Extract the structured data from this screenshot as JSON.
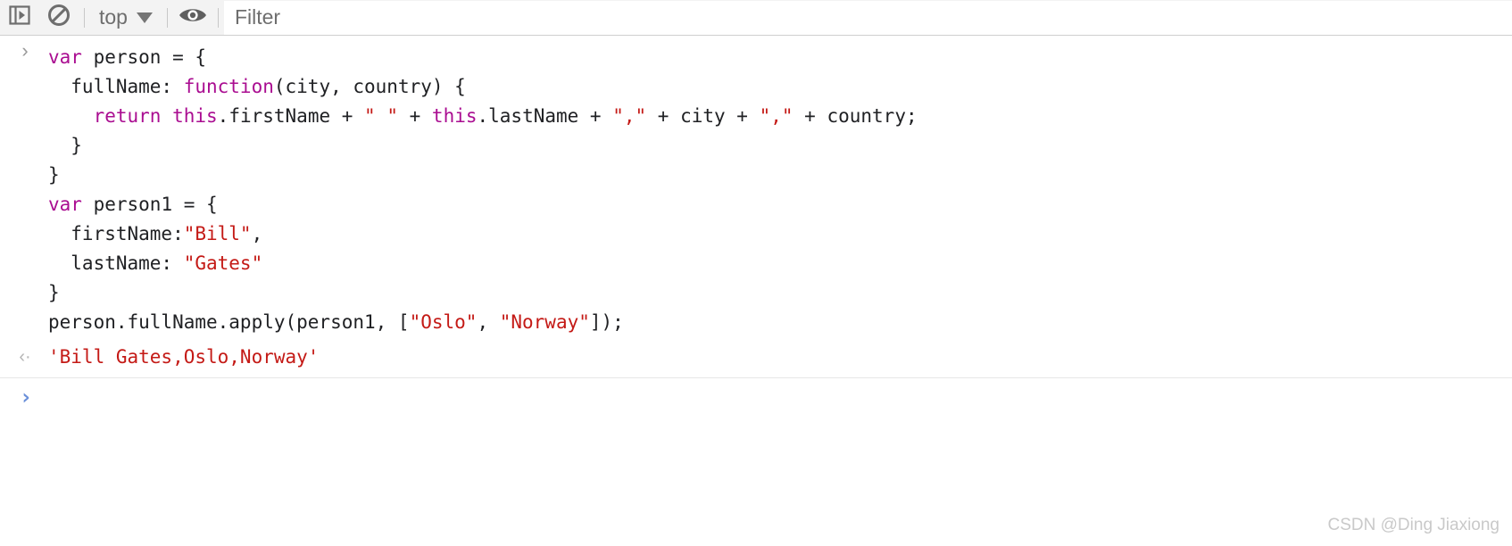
{
  "toolbar": {
    "drawer_toggle_icon": "sidebar-panel-icon",
    "clear_console_icon": "clear-console-icon",
    "context_label": "top",
    "context_caret_icon": "chevron-down-icon",
    "eye_icon": "eye-icon",
    "filter": {
      "placeholder": "Filter",
      "value": ""
    }
  },
  "console": {
    "input_marker": "›",
    "output_marker": "‹·",
    "prompt_marker": "›",
    "prompt_value": "",
    "entry": {
      "lines": [
        [
          {
            "t": "var",
            "c": "kw"
          },
          {
            "t": " person = {",
            "c": "pl"
          }
        ],
        [
          {
            "t": "  fullName: ",
            "c": "pl"
          },
          {
            "t": "function",
            "c": "kw"
          },
          {
            "t": "(city, country) {",
            "c": "pl"
          }
        ],
        [
          {
            "t": "    ",
            "c": "pl"
          },
          {
            "t": "return",
            "c": "kw"
          },
          {
            "t": " ",
            "c": "pl"
          },
          {
            "t": "this",
            "c": "kw"
          },
          {
            "t": ".firstName + ",
            "c": "pl"
          },
          {
            "t": "\" \"",
            "c": "str"
          },
          {
            "t": " + ",
            "c": "pl"
          },
          {
            "t": "this",
            "c": "kw"
          },
          {
            "t": ".lastName + ",
            "c": "pl"
          },
          {
            "t": "\",\"",
            "c": "str"
          },
          {
            "t": " + city + ",
            "c": "pl"
          },
          {
            "t": "\",\"",
            "c": "str"
          },
          {
            "t": " + country;",
            "c": "pl"
          }
        ],
        [
          {
            "t": "  }",
            "c": "pl"
          }
        ],
        [
          {
            "t": "}",
            "c": "pl"
          }
        ],
        [
          {
            "t": "var",
            "c": "kw"
          },
          {
            "t": " person1 = {",
            "c": "pl"
          }
        ],
        [
          {
            "t": "  firstName:",
            "c": "pl"
          },
          {
            "t": "\"Bill\"",
            "c": "str"
          },
          {
            "t": ",",
            "c": "pl"
          }
        ],
        [
          {
            "t": "  lastName: ",
            "c": "pl"
          },
          {
            "t": "\"Gates\"",
            "c": "str"
          }
        ],
        [
          {
            "t": "}",
            "c": "pl"
          }
        ],
        [
          {
            "t": "person.fullName.apply(person1, [",
            "c": "pl"
          },
          {
            "t": "\"Oslo\"",
            "c": "str"
          },
          {
            "t": ", ",
            "c": "pl"
          },
          {
            "t": "\"Norway\"",
            "c": "str"
          },
          {
            "t": "]);",
            "c": "pl"
          }
        ]
      ]
    },
    "result": "'Bill Gates,Oslo,Norway'"
  },
  "watermark": "CSDN @Ding Jiaxiong",
  "colors": {
    "keyword": "#aa0d91",
    "string": "#c41a16",
    "plain": "#202124",
    "prompt_blue": "#6b90d9",
    "toolbar_bg": "#f3f3f3"
  }
}
